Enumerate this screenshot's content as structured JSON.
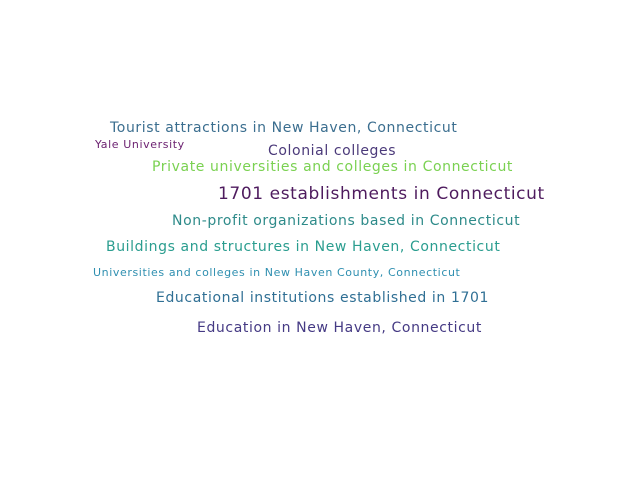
{
  "words": [
    {
      "text": "Tourist attractions in New Haven, Connecticut",
      "color": "#3b6e8f"
    },
    {
      "text": "Yale University",
      "color": "#6a1f6f"
    },
    {
      "text": "Colonial colleges",
      "color": "#4b3a7a"
    },
    {
      "text": "Private universities and colleges in Connecticut",
      "color": "#7ad151"
    },
    {
      "text": "1701 establishments in Connecticut",
      "color": "#4e1b5e"
    },
    {
      "text": "Non-profit organizations based in Connecticut",
      "color": "#2e8b8a"
    },
    {
      "text": "Buildings and structures in New Haven, Connecticut",
      "color": "#2a9d8f"
    },
    {
      "text": "Universities and colleges in New Haven County, Connecticut",
      "color": "#2f8fb0"
    },
    {
      "text": "Educational institutions established in 1701",
      "color": "#2f6f94"
    },
    {
      "text": "Education in New Haven, Connecticut",
      "color": "#453a84"
    }
  ]
}
